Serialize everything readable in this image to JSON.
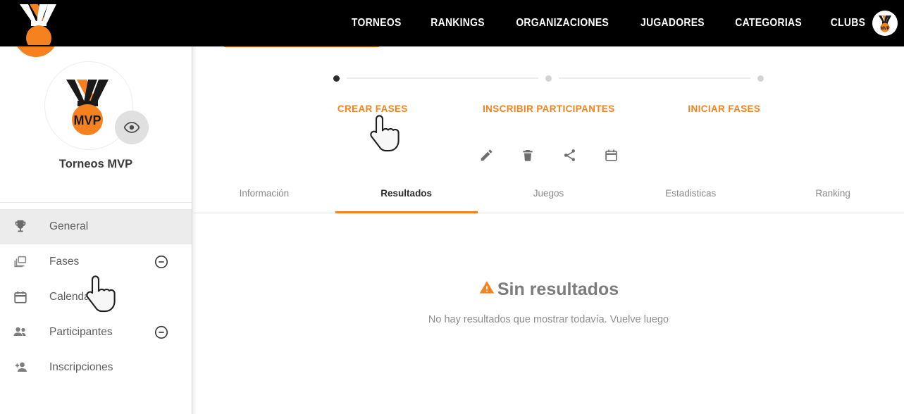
{
  "brand": {
    "name": "MVP",
    "logo_icon": "medal-logo-icon"
  },
  "topnav": {
    "links": [
      {
        "label": "TORNEOS",
        "name": "nav-link-torneos"
      },
      {
        "label": "RANKINGS",
        "name": "nav-link-rankings"
      },
      {
        "label": "ORGANIZACIONES",
        "name": "nav-link-organizaciones"
      },
      {
        "label": "JUGADORES",
        "name": "nav-link-jugadores"
      },
      {
        "label": "CATEGORIAS",
        "name": "nav-link-categorias"
      },
      {
        "label": "CLUBS",
        "name": "nav-link-clubs"
      }
    ],
    "avatar_icon": "user-avatar-medal-icon"
  },
  "sidebar": {
    "profile": {
      "badge_text": "MVP",
      "name": "Torneos MVP",
      "avatar_icon": "medal-logo-icon",
      "preview_icon": "eye-icon"
    },
    "items": [
      {
        "label": "General",
        "icon": "trophy-icon",
        "active": true,
        "collapsible": false
      },
      {
        "label": "Fases",
        "icon": "layers-icon",
        "active": false,
        "collapsible": true
      },
      {
        "label": "Calendario",
        "icon": "calendar-icon",
        "active": false,
        "collapsible": false
      },
      {
        "label": "Participantes",
        "icon": "people-icon",
        "active": false,
        "collapsible": true
      },
      {
        "label": "Inscripciones",
        "icon": "person-add-icon",
        "active": false,
        "collapsible": false
      }
    ],
    "collapse_icon": "minus-circle-icon"
  },
  "main": {
    "stepper": {
      "steps": [
        {
          "label": "CREAR FASES",
          "active": true
        },
        {
          "label": "INSCRIBIR PARTICIPANTES",
          "active": false
        },
        {
          "label": "INICIAR FASES",
          "active": false
        }
      ]
    },
    "actions": [
      {
        "name": "edit-button",
        "icon": "pencil-icon"
      },
      {
        "name": "delete-button",
        "icon": "trash-icon"
      },
      {
        "name": "share-button",
        "icon": "share-icon"
      },
      {
        "name": "calendar-button",
        "icon": "calendar-icon"
      }
    ],
    "tabs": [
      {
        "label": "Información",
        "active": false
      },
      {
        "label": "Resultados",
        "active": true
      },
      {
        "label": "Juegos",
        "active": false
      },
      {
        "label": "Estadisticas",
        "active": false
      },
      {
        "label": "Ranking",
        "active": false
      }
    ],
    "empty_state": {
      "icon": "warning-triangle-icon",
      "title": "Sin resultados",
      "subtitle": "No hay resultados que mostrar todavía. Vuelve luego"
    }
  },
  "colors": {
    "accent_orange": "#F5821F",
    "topbar_black": "#000000",
    "sidebar_active": "#ECECEC",
    "text_gray": "#7C7C7C"
  }
}
